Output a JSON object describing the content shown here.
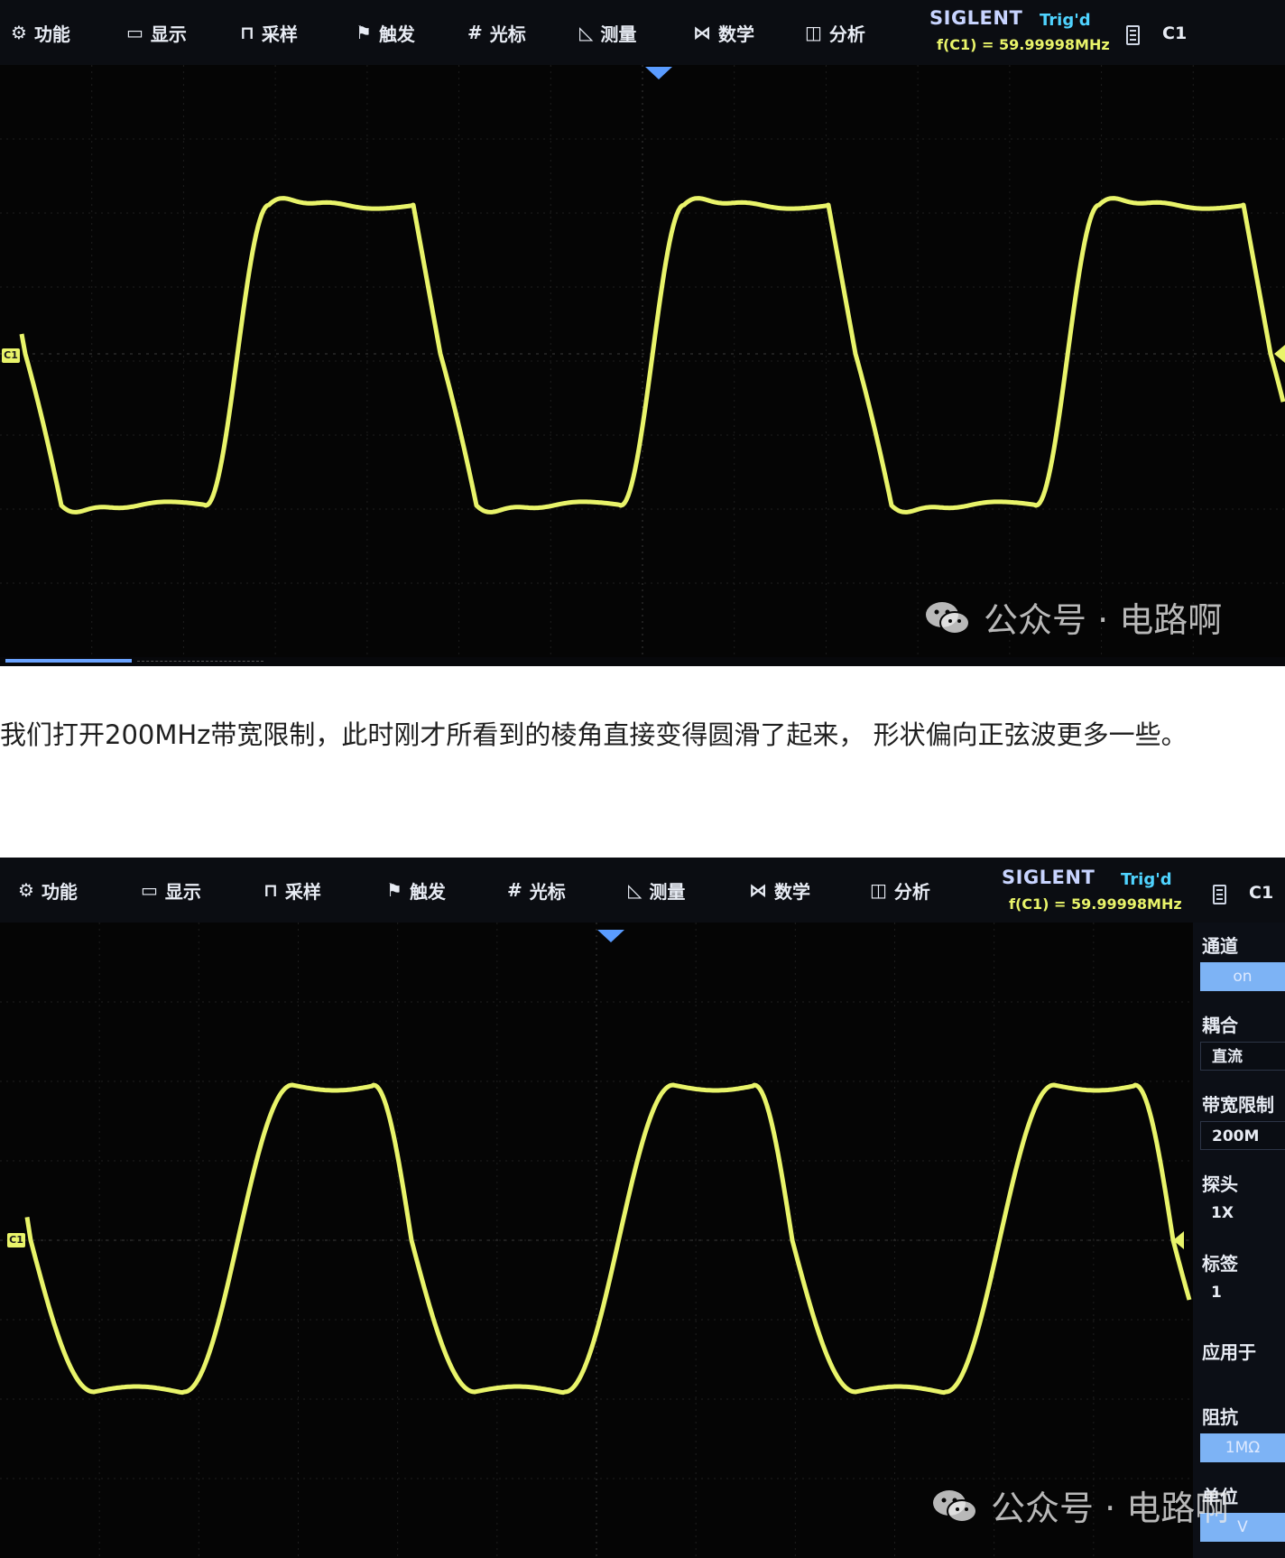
{
  "scope1": {
    "menu": [
      {
        "icon": "⚙",
        "icon_name": "gear-icon",
        "label": "功能"
      },
      {
        "icon": "▭",
        "icon_name": "display-icon",
        "label": "显示"
      },
      {
        "icon": "⊓",
        "icon_name": "acquire-icon",
        "label": "采样"
      },
      {
        "icon": "⚑",
        "icon_name": "flag-icon",
        "label": "触发"
      },
      {
        "icon": "#",
        "icon_name": "cursor-icon",
        "label": "光标"
      },
      {
        "icon": "◺",
        "icon_name": "measure-icon",
        "label": "测量"
      },
      {
        "icon": "⋈",
        "icon_name": "math-icon",
        "label": "数学"
      },
      {
        "icon": "◫",
        "icon_name": "analysis-icon",
        "label": "分析"
      }
    ],
    "brand": "SIGLENT",
    "trigger_status": "Trig'd",
    "frequency": "f(C1) = 59.99998MHz",
    "channel_indicator": "C1",
    "channel_marker": "C1",
    "watermark": "公众号 · 电路啊"
  },
  "article": {
    "paragraph": "我们打开200MHz带宽限制，此时刚才所看到的棱角直接变得圆滑了起来， 形状偏向正弦波更多一些。"
  },
  "scope2": {
    "menu": [
      {
        "icon": "⚙",
        "icon_name": "gear-icon",
        "label": "功能"
      },
      {
        "icon": "▭",
        "icon_name": "display-icon",
        "label": "显示"
      },
      {
        "icon": "⊓",
        "icon_name": "acquire-icon",
        "label": "采样"
      },
      {
        "icon": "⚑",
        "icon_name": "flag-icon",
        "label": "触发"
      },
      {
        "icon": "#",
        "icon_name": "cursor-icon",
        "label": "光标"
      },
      {
        "icon": "◺",
        "icon_name": "measure-icon",
        "label": "测量"
      },
      {
        "icon": "⋈",
        "icon_name": "math-icon",
        "label": "数学"
      },
      {
        "icon": "◫",
        "icon_name": "analysis-icon",
        "label": "分析"
      }
    ],
    "brand": "SIGLENT",
    "trigger_status": "Trig'd",
    "frequency": "f(C1) = 59.99998MHz",
    "channel_indicator": "C1",
    "channel_marker": "C1",
    "watermark": "公众号 · 电路啊",
    "side_panel": {
      "channel_label": "通道",
      "channel_value": "on",
      "coupling_label": "耦合",
      "coupling_value": "直流",
      "bw_limit_label": "带宽限制",
      "bw_limit_value": "200M",
      "probe_label": "探头",
      "probe_value": "1X",
      "tag_label": "标签",
      "tag_value": "1",
      "apply_to_label": "应用于",
      "impedance_label": "阻抗",
      "impedance_value": "1MΩ",
      "unit_label": "单位",
      "unit_value": "V"
    }
  },
  "colors": {
    "trace": "#e9f46a",
    "accent": "#5a9cff",
    "brand": "#c8d4ff",
    "trigger": "#4fd3ff"
  }
}
